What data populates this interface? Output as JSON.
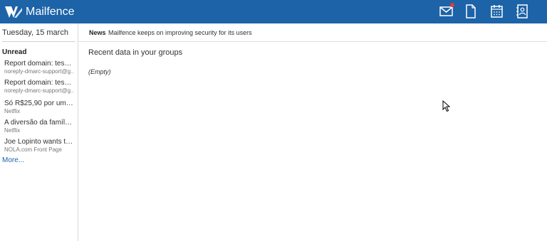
{
  "app": {
    "name": "Mailfence"
  },
  "header": {
    "icons": [
      "mail-icon",
      "document-icon",
      "calendar-icon",
      "contacts-icon"
    ],
    "brand_color": "#1c63a8",
    "notification_color": "#e53935"
  },
  "sidebar": {
    "date": "Tuesday, 15 march",
    "unread_title": "Unread",
    "items": [
      {
        "subject": "Report domain: test.c...",
        "sender": "noreply-dmarc-support@g..."
      },
      {
        "subject": "Report domain: test.c...",
        "sender": "noreply-dmarc-support@g..."
      },
      {
        "subject": "Só R$25,90 por um m...",
        "sender": "Netflix"
      },
      {
        "subject": "A diversão da família ...",
        "sender": "Netflix"
      },
      {
        "subject": "Joe Lopinto wants to ...",
        "sender": "NOLA.com Front Page"
      }
    ],
    "more": "More..."
  },
  "main": {
    "news_label": "News",
    "news_text": "Mailfence keeps on improving security for its users",
    "groups_title": "Recent data in your groups",
    "empty": "(Empty)"
  }
}
